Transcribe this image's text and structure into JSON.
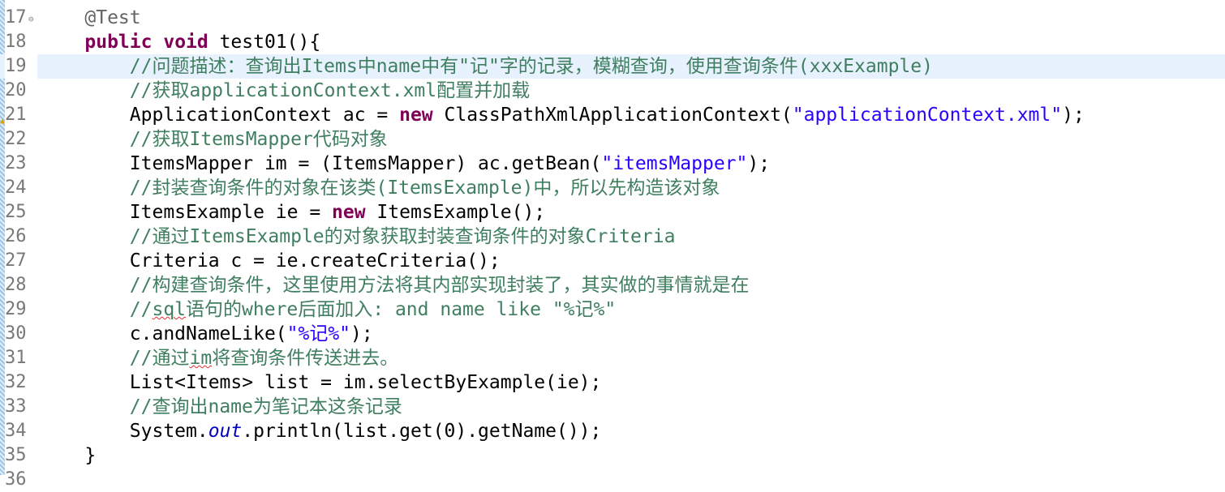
{
  "editor": {
    "current_line": 19,
    "lines": [
      {
        "num": "17",
        "fold": "collapse-icon",
        "tokens": [
          {
            "t": "    "
          },
          {
            "t": "@Test",
            "c": "ann"
          }
        ]
      },
      {
        "num": "18",
        "tokens": [
          {
            "t": "    "
          },
          {
            "t": "public",
            "c": "kw"
          },
          {
            "t": " "
          },
          {
            "t": "void",
            "c": "kw"
          },
          {
            "t": " test01(){"
          }
        ]
      },
      {
        "num": "19",
        "tokens": [
          {
            "t": "        "
          },
          {
            "t": "//问题描述：查询出Items中name中有\"记\"字的记录，模糊查询，使用查询条件(xxxExample)",
            "c": "cm"
          }
        ]
      },
      {
        "num": "20",
        "tokens": [
          {
            "t": "        "
          },
          {
            "t": "//获取applicationContext.xml配置并加载",
            "c": "cm"
          }
        ]
      },
      {
        "num": "21",
        "warning": "warning-icon",
        "tokens": [
          {
            "t": "        ApplicationContext ac = "
          },
          {
            "t": "new",
            "c": "kw"
          },
          {
            "t": " ClassPathXmlApplicationContext("
          },
          {
            "t": "\"applicationContext.xml\"",
            "c": "str"
          },
          {
            "t": ");"
          }
        ]
      },
      {
        "num": "22",
        "tokens": [
          {
            "t": "        "
          },
          {
            "t": "//获取ItemsMapper代码对象",
            "c": "cm"
          }
        ]
      },
      {
        "num": "23",
        "tokens": [
          {
            "t": "        ItemsMapper im = (ItemsMapper) ac.getBean("
          },
          {
            "t": "\"itemsMapper\"",
            "c": "str"
          },
          {
            "t": ");"
          }
        ]
      },
      {
        "num": "24",
        "tokens": [
          {
            "t": "        "
          },
          {
            "t": "//封装查询条件的对象在该类(ItemsExample)中，所以先构造该对象",
            "c": "cm"
          }
        ]
      },
      {
        "num": "25",
        "tokens": [
          {
            "t": "        ItemsExample ie = "
          },
          {
            "t": "new",
            "c": "kw"
          },
          {
            "t": " ItemsExample();"
          }
        ]
      },
      {
        "num": "26",
        "tokens": [
          {
            "t": "        "
          },
          {
            "t": "//通过ItemsExample的对象获取封装查询条件的对象Criteria",
            "c": "cm"
          }
        ]
      },
      {
        "num": "27",
        "tokens": [
          {
            "t": "        Criteria c = ie.createCriteria();"
          }
        ]
      },
      {
        "num": "28",
        "tokens": [
          {
            "t": "        "
          },
          {
            "t": "//构建查询条件，这里使用方法将其内部实现封装了，其实做的事情就是在",
            "c": "cm"
          }
        ]
      },
      {
        "num": "29",
        "tokens": [
          {
            "t": "        "
          },
          {
            "t": "//",
            "c": "cm"
          },
          {
            "t": "sql",
            "c": "cm spell"
          },
          {
            "t": "语句的where后面加入: and name like \"%记%\"",
            "c": "cm"
          }
        ]
      },
      {
        "num": "30",
        "tokens": [
          {
            "t": "        c.andNameLike("
          },
          {
            "t": "\"%记%\"",
            "c": "str"
          },
          {
            "t": ");"
          }
        ]
      },
      {
        "num": "31",
        "tokens": [
          {
            "t": "        "
          },
          {
            "t": "//通过",
            "c": "cm"
          },
          {
            "t": "im",
            "c": "cm spell"
          },
          {
            "t": "将查询条件传送进去。",
            "c": "cm"
          }
        ]
      },
      {
        "num": "32",
        "tokens": [
          {
            "t": "        List<Items> list = im.selectByExample(ie);"
          }
        ]
      },
      {
        "num": "33",
        "tokens": [
          {
            "t": "        "
          },
          {
            "t": "//查询出name为笔记本这条记录",
            "c": "cm"
          }
        ]
      },
      {
        "num": "34",
        "tokens": [
          {
            "t": "        System."
          },
          {
            "t": "out",
            "c": "fld"
          },
          {
            "t": ".println(list.get(0).getName());"
          }
        ]
      },
      {
        "num": "35",
        "tokens": [
          {
            "t": "    }"
          }
        ]
      },
      {
        "num": "36",
        "tokens": [
          {
            "t": ""
          }
        ]
      }
    ]
  }
}
